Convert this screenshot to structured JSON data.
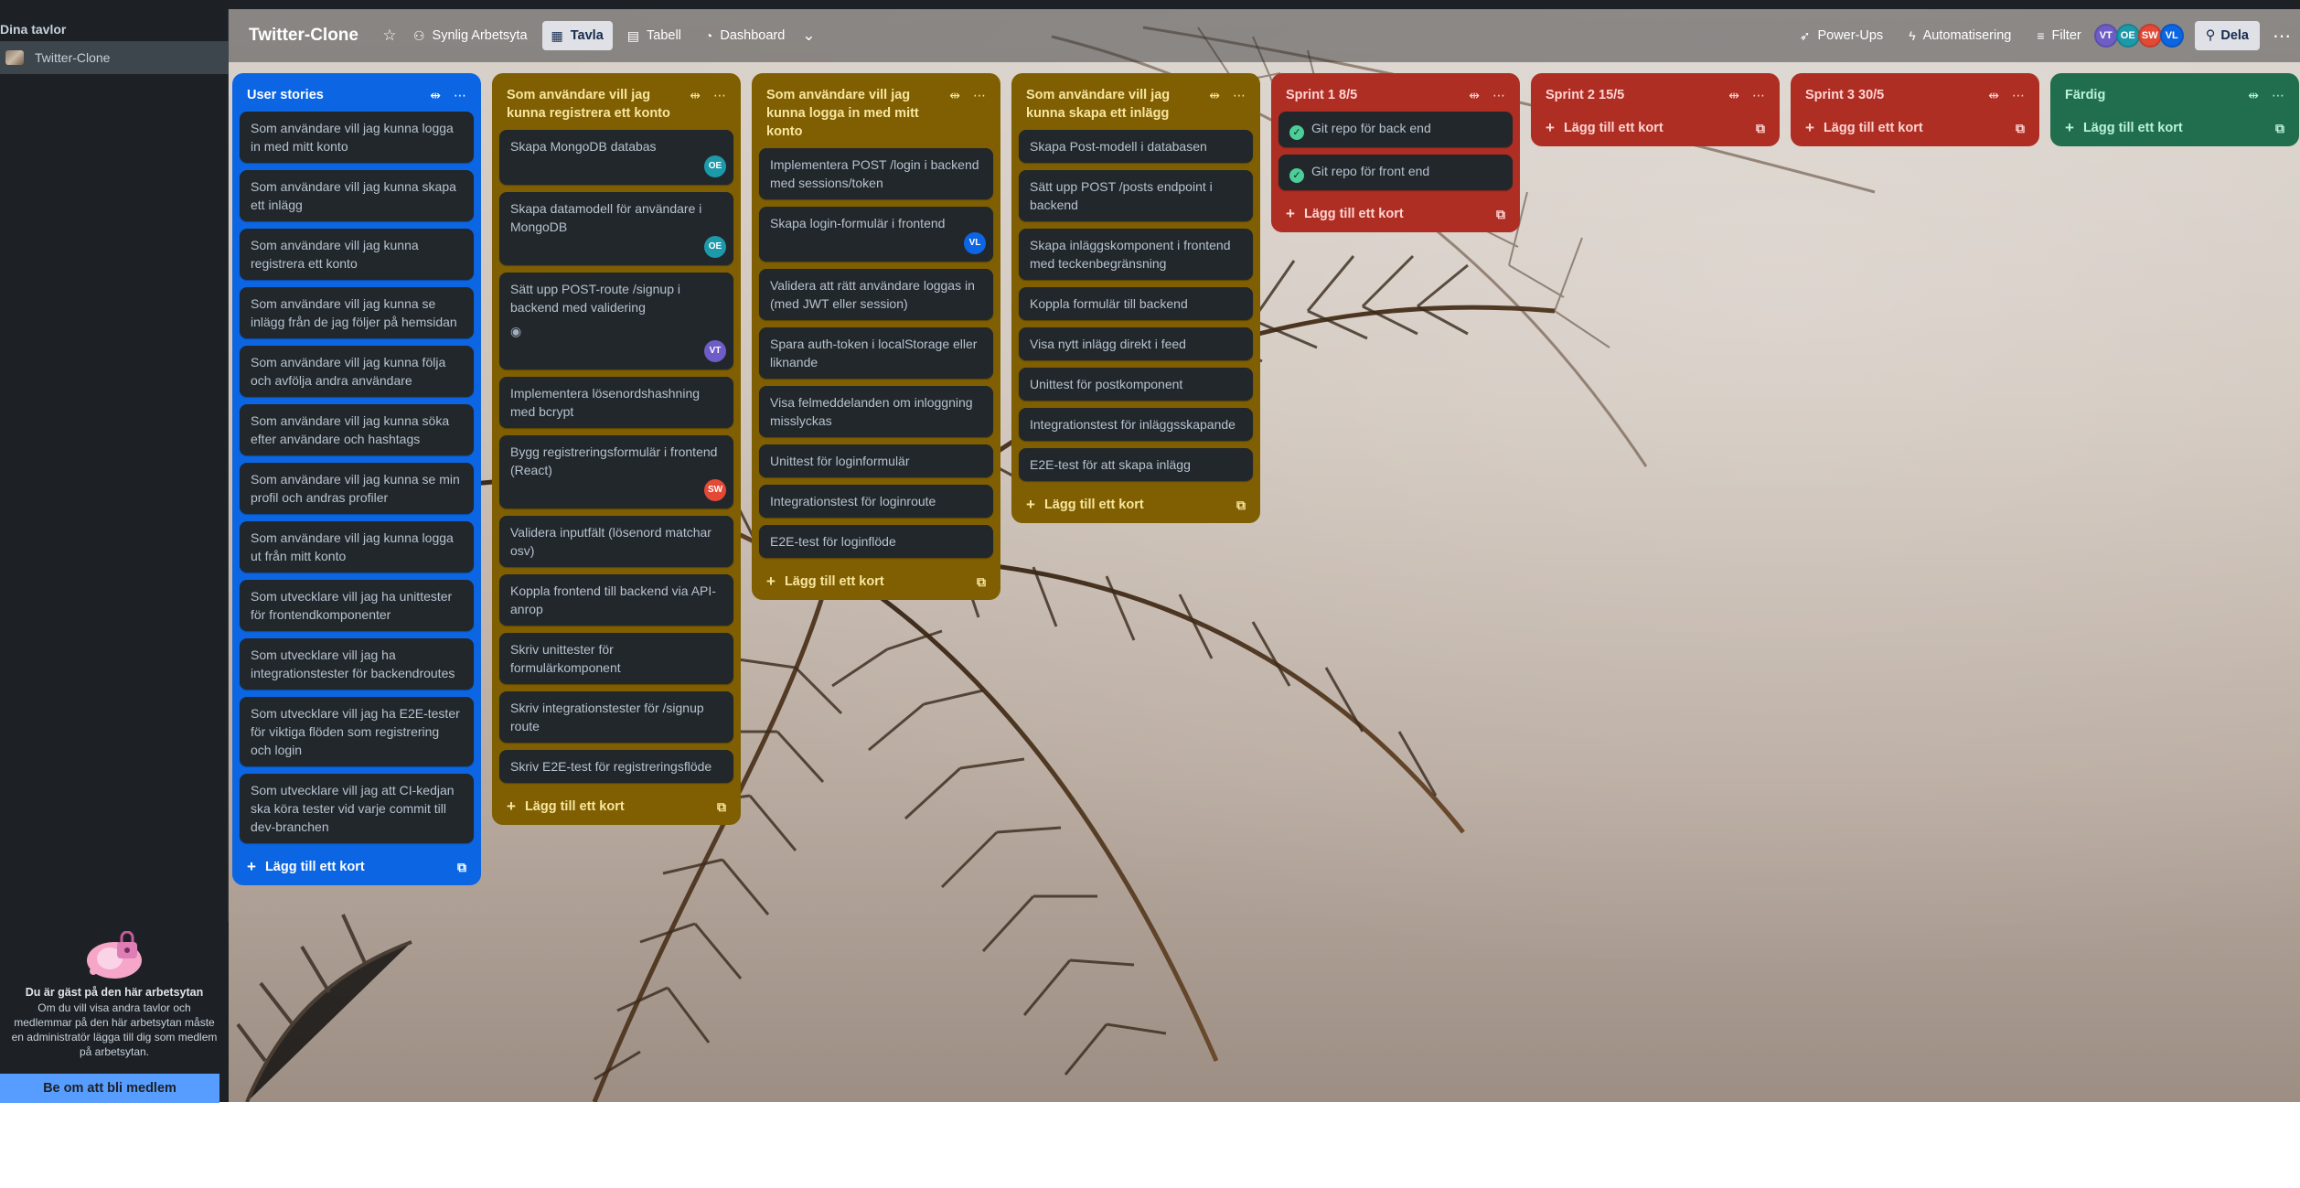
{
  "sidebar": {
    "heading": "Dina tavlor",
    "board": "Twitter-Clone",
    "guest": {
      "title": "Du är gäst på den här arbetsytan",
      "body": "Om du vill visa andra tavlor och medlemmar på den här arbetsytan måste en administratör lägga till dig som medlem på arbetsytan.",
      "button": "Be om att bli medlem"
    }
  },
  "boardbar": {
    "title": "Twitter-Clone",
    "visibility": "Synlig Arbetsyta",
    "views": {
      "board": "Tavla",
      "table": "Tabell",
      "dashboard": "Dashboard"
    },
    "powerups": "Power-Ups",
    "automation": "Automatisering",
    "filter": "Filter",
    "members": [
      {
        "initials": "VT",
        "color": "#6e5dc6"
      },
      {
        "initials": "OE",
        "color": "#1d9aaa"
      },
      {
        "initials": "SW",
        "color": "#e34935"
      },
      {
        "initials": "VL",
        "color": "#0c66e4"
      }
    ],
    "share": "Dela"
  },
  "add_card": "Lägg till ett kort",
  "lists": [
    {
      "title": "User stories",
      "cards": [
        {
          "text": "Som användare vill jag kunna logga in med mitt konto"
        },
        {
          "text": "Som användare vill jag kunna skapa ett inlägg"
        },
        {
          "text": "Som användare vill jag kunna registrera ett konto"
        },
        {
          "text": "Som användare vill jag kunna se inlägg från de jag följer på hemsidan"
        },
        {
          "text": "Som användare vill jag kunna följa och avfölja andra användare"
        },
        {
          "text": "Som användare vill jag kunna söka efter användare och hashtags"
        },
        {
          "text": "Som användare vill jag kunna se min profil och andras profiler"
        },
        {
          "text": "Som användare vill jag kunna logga ut från mitt konto"
        },
        {
          "text": "Som utvecklare vill jag ha unittester för frontendkomponenter"
        },
        {
          "text": "Som utvecklare vill jag ha integrationstester för backendroutes"
        },
        {
          "text": "Som utvecklare vill jag ha E2E-tester för viktiga flöden som registrering och login"
        },
        {
          "text": "Som utvecklare vill jag att CI-kedjan ska köra tester vid varje commit till dev-branchen"
        }
      ]
    },
    {
      "title": "Som användare vill jag kunna registrera ett konto",
      "cards": [
        {
          "text": "Skapa MongoDB databas",
          "member": "OE",
          "member_color": "#1d9aaa"
        },
        {
          "text": "Skapa datamodell för användare i MongoDB",
          "member": "OE",
          "member_color": "#1d9aaa"
        },
        {
          "text": "Sätt upp POST-route /signup i backend med validering",
          "member": "VT",
          "member_color": "#6e5dc6",
          "watch": true
        },
        {
          "text": "Implementera lösenordshashning med bcrypt"
        },
        {
          "text": "Bygg registreringsformulär i frontend (React)",
          "member": "SW",
          "member_color": "#e34935"
        },
        {
          "text": "Validera inputfält (lösenord matchar osv)"
        },
        {
          "text": "Koppla frontend till backend via API-anrop"
        },
        {
          "text": "Skriv unittester för formulärkomponent"
        },
        {
          "text": "Skriv integrationstester för /signup route"
        },
        {
          "text": "Skriv E2E-test för registreringsflöde"
        }
      ]
    },
    {
      "title": "Som användare vill jag kunna logga in med mitt konto",
      "cards": [
        {
          "text": "Implementera POST /login i backend med sessions/token"
        },
        {
          "text": "Skapa login-formulär i frontend",
          "member": "VL",
          "member_color": "#0c66e4"
        },
        {
          "text": "Validera att rätt användare loggas in (med JWT eller session)"
        },
        {
          "text": "Spara auth-token i localStorage eller liknande"
        },
        {
          "text": "Visa felmeddelanden om inloggning misslyckas"
        },
        {
          "text": "Unittest för loginformulär"
        },
        {
          "text": "Integrationstest för loginroute"
        },
        {
          "text": "E2E-test för loginflöde"
        }
      ]
    },
    {
      "title": "Som användare vill jag kunna skapa ett inlägg",
      "cards": [
        {
          "text": "Skapa Post-modell i databasen"
        },
        {
          "text": "Sätt upp POST /posts endpoint i backend"
        },
        {
          "text": "Skapa inläggskomponent i frontend med teckenbegränsning"
        },
        {
          "text": "Koppla formulär till backend"
        },
        {
          "text": "Visa nytt inlägg direkt i feed"
        },
        {
          "text": "Unittest för postkomponent"
        },
        {
          "text": "Integrationstest för inläggsskapande"
        },
        {
          "text": "E2E-test för att skapa inlägg"
        }
      ]
    },
    {
      "title": "Sprint 1 8/5",
      "cards": [
        {
          "text": "Git repo för back end",
          "done": true
        },
        {
          "text": "Git repo för front end",
          "done": true
        }
      ]
    },
    {
      "title": "Sprint 2 15/5",
      "cards": []
    },
    {
      "title": "Sprint 3 30/5",
      "cards": []
    },
    {
      "title": "Färdig",
      "cards": []
    }
  ]
}
